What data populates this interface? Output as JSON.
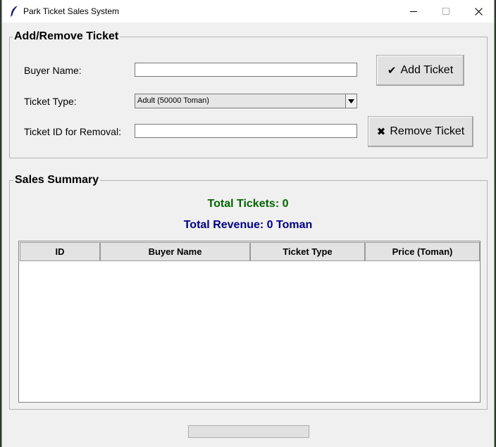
{
  "window": {
    "title": "Park Ticket Sales System"
  },
  "add_remove": {
    "group_title": "Add/Remove Ticket",
    "buyer_name_label": "Buyer Name:",
    "buyer_name_value": "",
    "ticket_type_label": "Ticket Type:",
    "ticket_type_selected": "Adult (50000 Toman)",
    "ticket_id_label": "Ticket ID for Removal:",
    "ticket_id_value": "",
    "add_button_icon": "✔",
    "add_button_label": "Add Ticket",
    "remove_button_icon": "✖",
    "remove_button_label": "Remove Ticket"
  },
  "summary": {
    "group_title": "Sales Summary",
    "total_tickets": "Total Tickets: 0",
    "total_revenue": "Total Revenue: 0 Toman",
    "colors": {
      "tickets": "#006400",
      "revenue": "#000080"
    },
    "columns": [
      "ID",
      "Buyer Name",
      "Ticket Type",
      "Price (Toman)"
    ],
    "rows": []
  },
  "footer": {
    "button_label": ""
  }
}
